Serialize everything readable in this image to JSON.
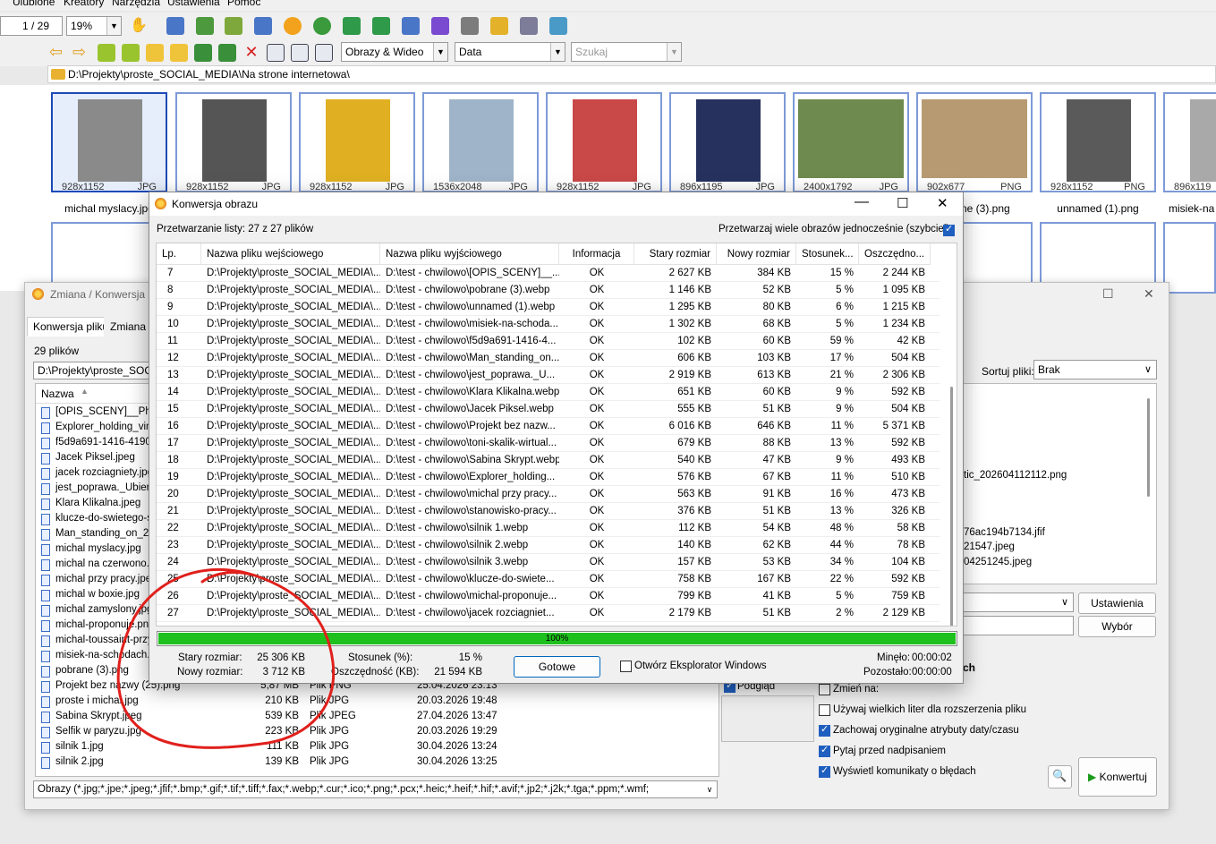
{
  "menu": {
    "items": [
      "Ulubione",
      "Kreatory",
      "Narzędzia",
      "Ustawienia",
      "Pomoc"
    ]
  },
  "toolbar": {
    "page_indicator": "1 / 29",
    "zoom": "19%"
  },
  "toolbar2": {
    "filter_value": "Obrazy & Wideo",
    "sort_value": "Data",
    "search_placeholder": "Szukaj"
  },
  "path": "D:\\Projekty\\proste_SOCIAL_MEDIA\\Na strone internetowa\\",
  "thumbnails": [
    {
      "dim": "928x1152",
      "fmt": "JPG",
      "name": "michal myslacy.jpg",
      "color": "#8a8a8a"
    },
    {
      "dim": "928x1152",
      "fmt": "JPG",
      "name": "",
      "color": "#555555"
    },
    {
      "dim": "928x1152",
      "fmt": "JPG",
      "name": "",
      "color": "#e0b022"
    },
    {
      "dim": "1536x2048",
      "fmt": "JPG",
      "name": "",
      "color": "#9fb4c8"
    },
    {
      "dim": "928x1152",
      "fmt": "JPG",
      "name": "",
      "color": "#c94848"
    },
    {
      "dim": "896x1195",
      "fmt": "JPG",
      "name": "",
      "color": "#26315e"
    },
    {
      "dim": "2400x1792",
      "fmt": "JPG",
      "name": "",
      "color": "#6f8a4f"
    },
    {
      "dim": "902x677",
      "fmt": "PNG",
      "name": "ne (3).png",
      "color": "#b89a72"
    },
    {
      "dim": "928x1152",
      "fmt": "PNG",
      "name": "unnamed (1).png",
      "color": "#5a5a5a"
    },
    {
      "dim": "896x119",
      "fmt": "",
      "name": "misiek-na",
      "color": "#a9a9a9"
    }
  ],
  "back_window": {
    "title": "Zmiana / Konwersja",
    "tabs": [
      "Konwersja pliku",
      "Zmiana na"
    ],
    "file_count": "29 plików",
    "path": "D:\\Projekty\\proste_SOCIA",
    "col_name": "Nazwa",
    "files": [
      {
        "name": "[OPIS_SCENY]__Photo",
        "size": "",
        "type": "",
        "date": ""
      },
      {
        "name": "Explorer_holding_vinta",
        "size": "",
        "type": "",
        "date": ""
      },
      {
        "name": "f5d9a691-1416-4190-",
        "size": "",
        "type": "",
        "date": ""
      },
      {
        "name": "Jacek Piksel.jpeg",
        "size": "",
        "type": "",
        "date": ""
      },
      {
        "name": "jacek rozciagniety.jpg",
        "size": "",
        "type": "",
        "date": ""
      },
      {
        "name": "jest_poprawa._Ubierz",
        "size": "",
        "type": "",
        "date": ""
      },
      {
        "name": "Klara Klikalna.jpeg",
        "size": "",
        "type": "",
        "date": ""
      },
      {
        "name": "klucze-do-swietego-sp",
        "size": "",
        "type": "",
        "date": ""
      },
      {
        "name": "Man_standing_on_202",
        "size": "",
        "type": "",
        "date": ""
      },
      {
        "name": "michal myslacy.jpg",
        "size": "",
        "type": "",
        "date": ""
      },
      {
        "name": "michal na czerwono.jp",
        "size": "",
        "type": "",
        "date": ""
      },
      {
        "name": "michal przy pracy.jpeg",
        "size": "",
        "type": "",
        "date": ""
      },
      {
        "name": "michal w boxie.jpg",
        "size": "",
        "type": "",
        "date": ""
      },
      {
        "name": "michal zamyslony.jpg",
        "size": "",
        "type": "",
        "date": ""
      },
      {
        "name": "michal-proponuje.png",
        "size": "",
        "type": "",
        "date": ""
      },
      {
        "name": "michal-toussaint-przy-",
        "size": "",
        "type": "",
        "date": ""
      },
      {
        "name": "misiek-na-schodach.pr",
        "size": "",
        "type": "",
        "date": ""
      },
      {
        "name": "pobrane (3).png",
        "size": "",
        "type": "",
        "date": ""
      },
      {
        "name": "Projekt bez nazwy (25).png",
        "size": "5,87 MB",
        "type": "Plik PNG",
        "date": "25.04.2026 23:13"
      },
      {
        "name": "proste i michal.jpg",
        "size": "210 KB",
        "type": "Plik JPG",
        "date": "20.03.2026 19:48"
      },
      {
        "name": "Sabina Skrypt.jpeg",
        "size": "539 KB",
        "type": "Plik JPEG",
        "date": "27.04.2026 13:47"
      },
      {
        "name": "Selfik w paryzu.jpg",
        "size": "223 KB",
        "type": "Plik JPG",
        "date": "20.03.2026 19:29"
      },
      {
        "name": "silnik 1.jpg",
        "size": "111 KB",
        "type": "Plik JPG",
        "date": "30.04.2026 13:24"
      },
      {
        "name": "silnik 2.jpg",
        "size": "139 KB",
        "type": "Plik JPG",
        "date": "30.04.2026 13:25"
      }
    ],
    "filter": "Obrazy (*.jpg;*.jpe;*.jpeg;*.jfif;*.bmp;*.gif;*.tif;*.tiff;*.fax;*.webp;*.cur;*.ico;*.png;*.pcx;*.heic;*.heif;*.hif;*.avif;*.jp2;*.j2k;*.tga;*.ppm;*.wmf;",
    "sort_label": "Sortuj pliki:",
    "sort_value": "Brak",
    "right_files": [
      "tic_202604112112.png",
      "76ac194b7134.jfif",
      "21547.jpeg",
      "04251245.jpeg"
    ],
    "settings_btn": "Ustawienia",
    "choose_btn": "Wybór",
    "preview_label": "Podgląd",
    "rename_label": "Zmień na:",
    "options": [
      {
        "label": "Używaj wielkich liter dla rozszerzenia pliku",
        "checked": false
      },
      {
        "label": "Zachowaj oryginalne atrybuty daty/czasu",
        "checked": true
      },
      {
        "label": "Pytaj przed nadpisaniem",
        "checked": true
      },
      {
        "label": "Wyświetl komunikaty o błędach",
        "checked": true
      }
    ],
    "convert_btn": "Konwertuj",
    "partial_label": "ch"
  },
  "dialog": {
    "title": "Konwersja obrazu",
    "processing": "Przetwarzanie listy: 27 z 27 plików",
    "multi_label": "Przetwarzaj wiele obrazów jednocześnie (szybciej):",
    "columns": [
      "Lp.",
      "Nazwa pliku wejściowego",
      "Nazwa pliku wyjściowego",
      "Informacja",
      "Stary rozmiar",
      "Nowy rozmiar",
      "Stosunek...",
      "Oszczędno..."
    ],
    "rows": [
      [
        "7",
        "D:\\Projekty\\proste_SOCIAL_MEDIA\\...",
        "D:\\test - chwilowo\\[OPIS_SCENY]__...",
        "OK",
        "2 627 KB",
        "384 KB",
        "15 %",
        "2 244 KB"
      ],
      [
        "8",
        "D:\\Projekty\\proste_SOCIAL_MEDIA\\...",
        "D:\\test - chwilowo\\pobrane (3).webp",
        "OK",
        "1 146 KB",
        "52 KB",
        "5 %",
        "1 095 KB"
      ],
      [
        "9",
        "D:\\Projekty\\proste_SOCIAL_MEDIA\\...",
        "D:\\test - chwilowo\\unnamed (1).webp",
        "OK",
        "1 295 KB",
        "80 KB",
        "6 %",
        "1 215 KB"
      ],
      [
        "10",
        "D:\\Projekty\\proste_SOCIAL_MEDIA\\...",
        "D:\\test - chwilowo\\misiek-na-schoda...",
        "OK",
        "1 302 KB",
        "68 KB",
        "5 %",
        "1 234 KB"
      ],
      [
        "11",
        "D:\\Projekty\\proste_SOCIAL_MEDIA\\...",
        "D:\\test - chwilowo\\f5d9a691-1416-4...",
        "OK",
        "102 KB",
        "60 KB",
        "59 %",
        "42 KB"
      ],
      [
        "12",
        "D:\\Projekty\\proste_SOCIAL_MEDIA\\...",
        "D:\\test - chwilowo\\Man_standing_on...",
        "OK",
        "606 KB",
        "103 KB",
        "17 %",
        "504 KB"
      ],
      [
        "13",
        "D:\\Projekty\\proste_SOCIAL_MEDIA\\...",
        "D:\\test - chwilowo\\jest_poprawa._U...",
        "OK",
        "2 919 KB",
        "613 KB",
        "21 %",
        "2 306 KB"
      ],
      [
        "14",
        "D:\\Projekty\\proste_SOCIAL_MEDIA\\...",
        "D:\\test - chwilowo\\Klara Klikalna.webp",
        "OK",
        "651 KB",
        "60 KB",
        "9 %",
        "592 KB"
      ],
      [
        "15",
        "D:\\Projekty\\proste_SOCIAL_MEDIA\\...",
        "D:\\test - chwilowo\\Jacek Piksel.webp",
        "OK",
        "555 KB",
        "51 KB",
        "9 %",
        "504 KB"
      ],
      [
        "16",
        "D:\\Projekty\\proste_SOCIAL_MEDIA\\...",
        "D:\\test - chwilowo\\Projekt bez nazw...",
        "OK",
        "6 016 KB",
        "646 KB",
        "11 %",
        "5 371 KB"
      ],
      [
        "17",
        "D:\\Projekty\\proste_SOCIAL_MEDIA\\...",
        "D:\\test - chwilowo\\toni-skalik-wirtual...",
        "OK",
        "679 KB",
        "88 KB",
        "13 %",
        "592 KB"
      ],
      [
        "18",
        "D:\\Projekty\\proste_SOCIAL_MEDIA\\...",
        "D:\\test - chwilowo\\Sabina Skrypt.webp",
        "OK",
        "540 KB",
        "47 KB",
        "9 %",
        "493 KB"
      ],
      [
        "19",
        "D:\\Projekty\\proste_SOCIAL_MEDIA\\...",
        "D:\\test - chwilowo\\Explorer_holding...",
        "OK",
        "576 KB",
        "67 KB",
        "11 %",
        "510 KB"
      ],
      [
        "20",
        "D:\\Projekty\\proste_SOCIAL_MEDIA\\...",
        "D:\\test - chwilowo\\michal przy pracy...",
        "OK",
        "563 KB",
        "91 KB",
        "16 %",
        "473 KB"
      ],
      [
        "21",
        "D:\\Projekty\\proste_SOCIAL_MEDIA\\...",
        "D:\\test - chwilowo\\stanowisko-pracy...",
        "OK",
        "376 KB",
        "51 KB",
        "13 %",
        "326 KB"
      ],
      [
        "22",
        "D:\\Projekty\\proste_SOCIAL_MEDIA\\...",
        "D:\\test - chwilowo\\silnik 1.webp",
        "OK",
        "112 KB",
        "54 KB",
        "48 %",
        "58 KB"
      ],
      [
        "23",
        "D:\\Projekty\\proste_SOCIAL_MEDIA\\...",
        "D:\\test - chwilowo\\silnik 2.webp",
        "OK",
        "140 KB",
        "62 KB",
        "44 %",
        "78 KB"
      ],
      [
        "24",
        "D:\\Projekty\\proste_SOCIAL_MEDIA\\...",
        "D:\\test - chwilowo\\silnik 3.webp",
        "OK",
        "157 KB",
        "53 KB",
        "34 %",
        "104 KB"
      ],
      [
        "25",
        "D:\\Projekty\\proste_SOCIAL_MEDIA\\...",
        "D:\\test - chwilowo\\klucze-do-swiete...",
        "OK",
        "758 KB",
        "167 KB",
        "22 %",
        "592 KB"
      ],
      [
        "26",
        "D:\\Projekty\\proste_SOCIAL_MEDIA\\...",
        "D:\\test - chwilowo\\michal-proponuje...",
        "OK",
        "799 KB",
        "41 KB",
        "5 %",
        "759 KB"
      ],
      [
        "27",
        "D:\\Projekty\\proste_SOCIAL_MEDIA\\...",
        "D:\\test - chwilowo\\jacek rozciagniet...",
        "OK",
        "2 179 KB",
        "51 KB",
        "2 %",
        "2 129 KB"
      ]
    ],
    "progress_percent": 100,
    "progress_label": "100%",
    "old_size_label": "Stary rozmiar:",
    "old_size_value": "25 306 KB",
    "new_size_label": "Nowy rozmiar:",
    "new_size_value": "3 712 KB",
    "ratio_label": "Stosunek (%):",
    "ratio_value": "15 %",
    "savings_label": "Oszczędność (KB):",
    "savings_value": "21 594 KB",
    "done_btn": "Gotowe",
    "open_explorer_label": "Otwórz Eksplorator Windows",
    "elapsed_label": "Minęło:",
    "elapsed_value": "00:00:02",
    "remaining_label": "Pozostało:",
    "remaining_value": "00:00:00"
  },
  "colors": {
    "progress": "#1ec01e",
    "annotation": "#e0201c",
    "selected_thumb": "#1d4ab8"
  }
}
